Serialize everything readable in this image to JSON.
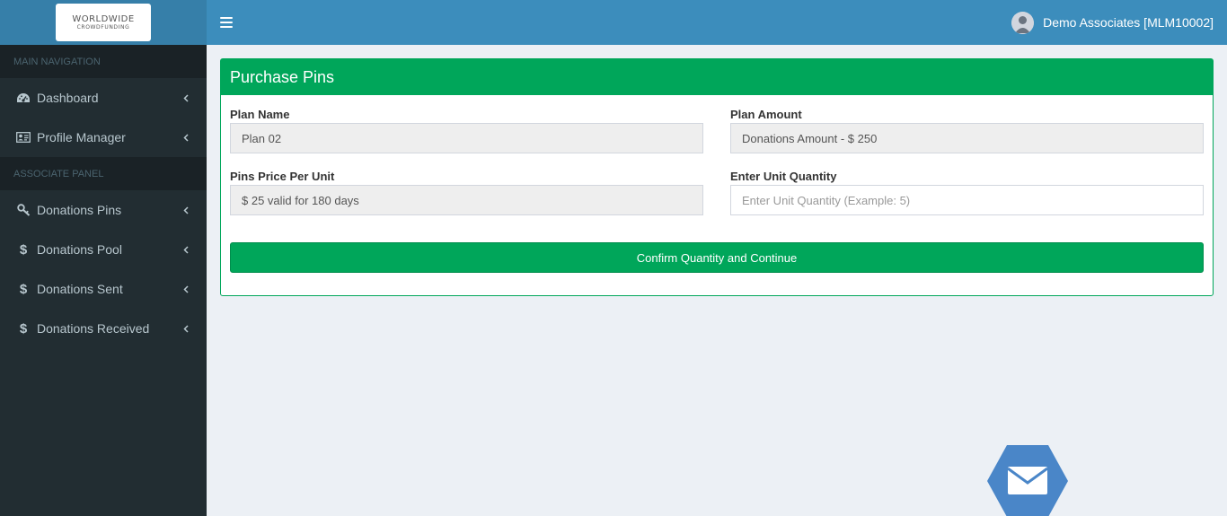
{
  "logo": {
    "line1": "WORLDWIDE",
    "line2": "CROWDFUNDING"
  },
  "sidebar": {
    "sections": [
      {
        "header": "MAIN NAVIGATION",
        "items": [
          {
            "label": "Dashboard",
            "icon": "dashboard-icon"
          },
          {
            "label": "Profile Manager",
            "icon": "id-card-icon"
          }
        ]
      },
      {
        "header": "ASSOCIATE PANEL",
        "items": [
          {
            "label": "Donations Pins",
            "icon": "key-icon"
          },
          {
            "label": "Donations Pool",
            "icon": "dollar-icon"
          },
          {
            "label": "Donations Sent",
            "icon": "dollar-icon"
          },
          {
            "label": "Donations Received",
            "icon": "dollar-icon"
          }
        ]
      }
    ]
  },
  "topbar": {
    "user_name": "Demo Associates [MLM10002]"
  },
  "form": {
    "title": "Purchase Pins",
    "plan_name_label": "Plan Name",
    "plan_name_value": "Plan 02",
    "plan_amount_label": "Plan Amount",
    "plan_amount_value": "Donations Amount - $ 250",
    "pin_price_label": "Pins Price Per Unit",
    "pin_price_value": "$ 25 valid for 180 days",
    "quantity_label": "Enter Unit Quantity",
    "quantity_placeholder": "Enter Unit Quantity (Example: 5)",
    "quantity_value": "",
    "confirm_label": "Confirm Quantity and Continue"
  },
  "colors": {
    "sidebar_bg": "#222d32",
    "topbar_bg": "#3c8dbc",
    "success": "#00a65a",
    "mail_button": "#4a86c8"
  }
}
